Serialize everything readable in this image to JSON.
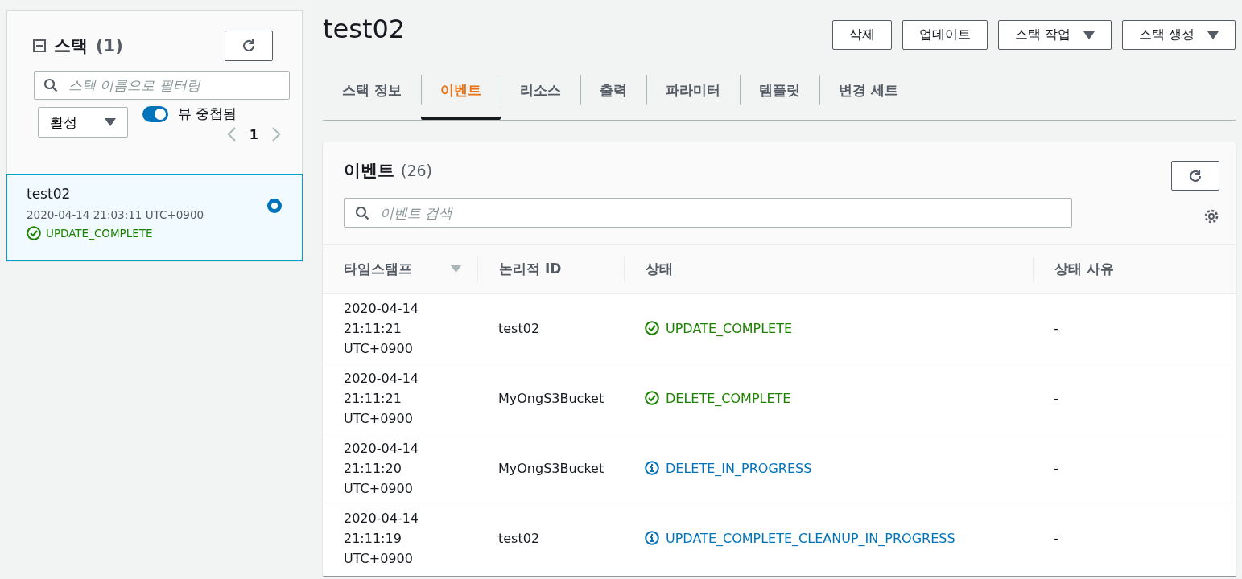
{
  "sidebar": {
    "title": "스택",
    "count": "(1)",
    "filter_placeholder": "스택 이름으로 필터링",
    "status_filter": "활성",
    "nested_view": {
      "label": "뷰 중첩됨",
      "on": true
    },
    "page": "1",
    "stacks": [
      {
        "name": "test02",
        "time": "2020-04-14 21:03:11 UTC+0900",
        "status": "UPDATE_COMPLETE",
        "kind": "success",
        "selected": true
      }
    ]
  },
  "stack": {
    "title": "test02",
    "buttons": [
      {
        "label": "삭제",
        "dropdown": false
      },
      {
        "label": "업데이트",
        "dropdown": false
      },
      {
        "label": "스택 작업",
        "dropdown": true
      },
      {
        "label": "스택 생성",
        "dropdown": true
      }
    ],
    "tabs": [
      {
        "label": "스택 정보",
        "selected": false
      },
      {
        "label": "이벤트",
        "selected": true
      },
      {
        "label": "리소스",
        "selected": false
      },
      {
        "label": "출력",
        "selected": false
      },
      {
        "label": "파라미터",
        "selected": false
      },
      {
        "label": "템플릿",
        "selected": false
      },
      {
        "label": "변경 세트",
        "selected": false
      }
    ]
  },
  "events": {
    "title": "이벤트",
    "count": "(26)",
    "search_placeholder": "이벤트 검색",
    "columns": [
      {
        "label": "타임스탬프",
        "sorted": true
      },
      {
        "label": "논리적 ID",
        "sorted": false
      },
      {
        "label": "상태",
        "sorted": false
      },
      {
        "label": "상태 사유",
        "sorted": false
      }
    ],
    "rows": [
      {
        "timestamp": "2020-04-14 21:11:21 UTC+0900",
        "logical_id": "test02",
        "status": "UPDATE_COMPLETE",
        "kind": "success",
        "reason": "-"
      },
      {
        "timestamp": "2020-04-14 21:11:21 UTC+0900",
        "logical_id": "MyOngS3Bucket",
        "status": "DELETE_COMPLETE",
        "kind": "success",
        "reason": "-"
      },
      {
        "timestamp": "2020-04-14 21:11:20 UTC+0900",
        "logical_id": "MyOngS3Bucket",
        "status": "DELETE_IN_PROGRESS",
        "kind": "info",
        "reason": "-"
      },
      {
        "timestamp": "2020-04-14 21:11:19 UTC+0900",
        "logical_id": "test02",
        "status": "UPDATE_COMPLETE_CLEANUP_IN_PROGRESS",
        "kind": "info",
        "reason": "-"
      }
    ]
  }
}
